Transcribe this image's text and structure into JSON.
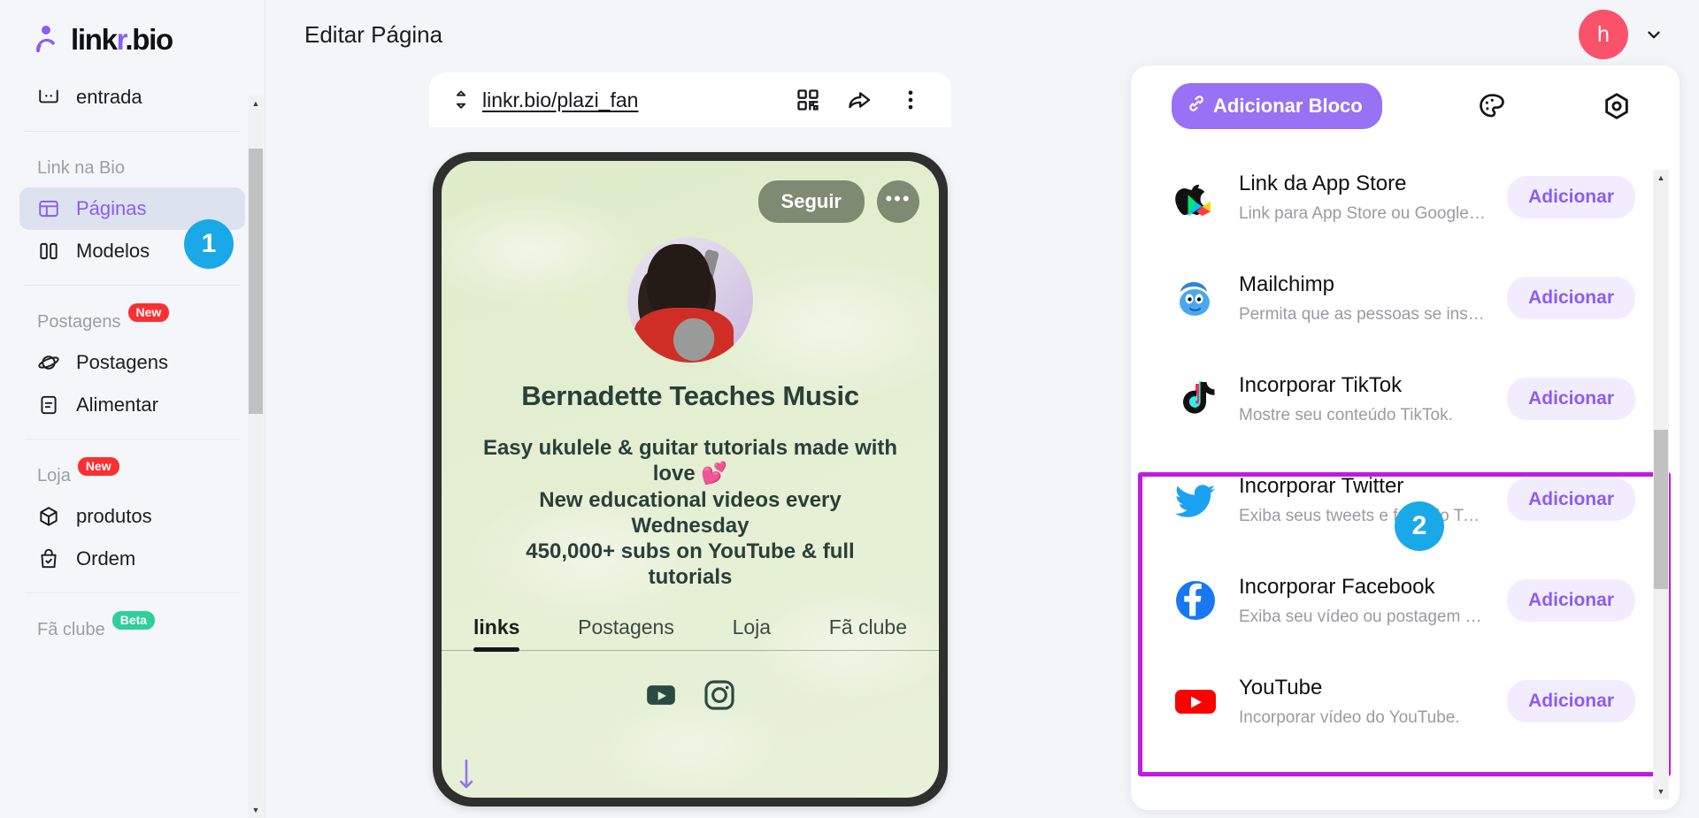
{
  "brand": {
    "name_prefix": "link",
    "name_accent": "r",
    "name_suffix": ".bio",
    "logo_icon": "linkr-logo-icon"
  },
  "accent_colors": {
    "purple": "#8b5cf6",
    "highlight": "#bf1ce0",
    "badge_blue": "#1aa9e8",
    "avatar_pink": "#f9526a",
    "new_pill": "#fa2f32",
    "beta_pill": "#2ecf9a"
  },
  "sidebar": {
    "inbox": {
      "label": "entrada",
      "icon": "inbox-icon"
    },
    "sections": [
      {
        "label": "Link na Bio",
        "badge": null,
        "items": [
          {
            "label": "Páginas",
            "icon": "layout-icon",
            "active": true,
            "badge": "1"
          },
          {
            "label": "Modelos",
            "icon": "columns-icon",
            "active": false
          }
        ]
      },
      {
        "label": "Postagens",
        "badge": "New",
        "items": [
          {
            "label": "Postagens",
            "icon": "planet-icon",
            "active": false
          },
          {
            "label": "Alimentar",
            "icon": "feed-icon",
            "active": false
          }
        ]
      },
      {
        "label": "Loja",
        "badge": "New",
        "items": [
          {
            "label": "produtos",
            "icon": "box-icon",
            "active": false
          },
          {
            "label": "Ordem",
            "icon": "bag-check-icon",
            "active": false
          }
        ]
      },
      {
        "label": "Fã clube",
        "badge": "Beta",
        "items": []
      }
    ]
  },
  "header": {
    "title": "Editar Página",
    "avatar_initial": "h",
    "chevron_icon": "chevron-down-icon"
  },
  "urlbar": {
    "sort_icon": "sort-updown-icon",
    "url": "linkr.bio/plazi_fan",
    "actions": [
      {
        "name": "qr-code-icon",
        "label": "QR Code"
      },
      {
        "name": "share-icon",
        "label": "Compartilhar"
      },
      {
        "name": "more-vertical-icon",
        "label": "Mais"
      }
    ]
  },
  "preview": {
    "follow_button": "Seguir",
    "more_button": "•••",
    "profile_name": "Bernadette Teaches Music",
    "bio_lines": [
      "Easy ukulele & guitar tutorials made with love 💕",
      "New educational videos every Wednesday",
      "450,000+ subs on YouTube & full tutorials"
    ],
    "tabs": [
      {
        "label": "links",
        "active": true
      },
      {
        "label": "Postagens",
        "active": false
      },
      {
        "label": "Loja",
        "active": false
      },
      {
        "label": "Fã clube",
        "active": false
      }
    ],
    "socials": [
      "youtube-icon",
      "instagram-icon"
    ]
  },
  "blocks_panel": {
    "add_block_button": "Adicionar Bloco",
    "add_block_icon": "link-chain-icon",
    "tools": [
      {
        "name": "palette-icon",
        "label": "Tema"
      },
      {
        "name": "settings-hexagon-icon",
        "label": "Configurações"
      }
    ],
    "add_label": "Adicionar",
    "items": [
      {
        "title": "Link da App Store",
        "subtitle": "Link para App Store ou Google P...",
        "icon": "appstore-playstore-icon",
        "highlighted": false
      },
      {
        "title": "Mailchimp",
        "subtitle": "Permita que as pessoas se inscr...",
        "icon": "mailchimp-icon",
        "highlighted": false
      },
      {
        "title": "Incorporar TikTok",
        "subtitle": "Mostre seu conteúdo TikTok.",
        "icon": "tiktok-icon",
        "highlighted": true
      },
      {
        "title": "Incorporar Twitter",
        "subtitle": "Exiba seus tweets e feed do Twi...",
        "icon": "twitter-icon",
        "highlighted": true
      },
      {
        "title": "Incorporar Facebook",
        "subtitle": "Exiba seu vídeo ou postagem no...",
        "icon": "facebook-icon",
        "highlighted": true
      },
      {
        "title": "YouTube",
        "subtitle": "Incorporar vídeo do YouTube.",
        "icon": "youtube-icon",
        "highlighted": false
      }
    ]
  },
  "step_badges": [
    {
      "number": "1"
    },
    {
      "number": "2"
    }
  ]
}
